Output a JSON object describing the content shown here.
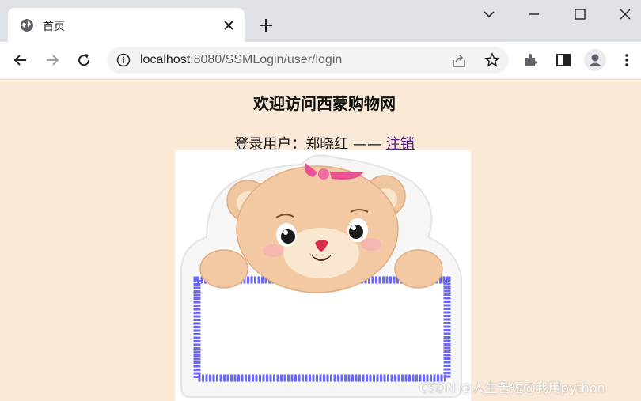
{
  "tab": {
    "title": "首页"
  },
  "window_controls": {
    "tab_search_icon": "chevron-down-icon",
    "minimize_icon": "minimize-icon",
    "maximize_icon": "maximize-icon",
    "close_icon": "close-icon"
  },
  "address_bar": {
    "host": "localhost",
    "rest": ":8080/SSMLogin/user/login"
  },
  "page": {
    "heading": "欢迎访问西蒙购物网",
    "user_prefix": "登录用户：郑晓红 —— ",
    "logout_link": "注销",
    "watermark": "CSDN @人生苦短@我用python"
  },
  "colors": {
    "page_background": "#fae9d7",
    "link": "#551a8b",
    "bear_frame": "#6b66f5"
  }
}
